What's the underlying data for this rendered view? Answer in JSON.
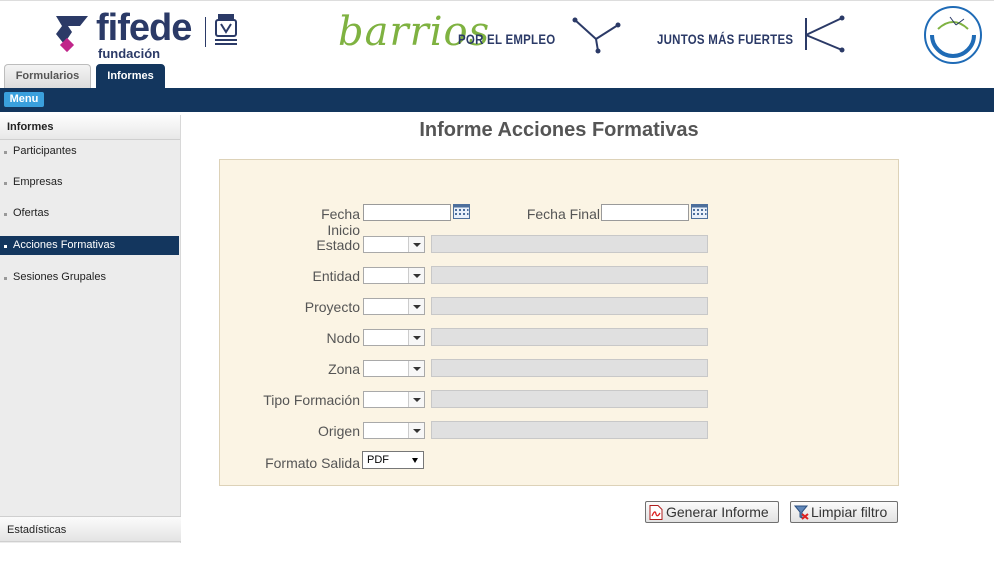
{
  "header": {
    "brand_word": "fifede",
    "brand_sub": "fundación",
    "partner_word": "barrios",
    "tagline_1": "POR EL EMPLEO",
    "tagline_2": "JUNTOS MÁS FUERTES",
    "colors": {
      "navy": "#13365e",
      "brand_blue": "#2b3a67",
      "green": "#7fb241",
      "accent": "#3aa0dd"
    }
  },
  "tabs": [
    {
      "label": "Formularios",
      "active": false
    },
    {
      "label": "Informes",
      "active": true
    }
  ],
  "navbar": {
    "menu_label": "Menu"
  },
  "sidebar": {
    "title": "Informes",
    "items": [
      {
        "label": "Participantes",
        "active": false
      },
      {
        "label": "Empresas",
        "active": false
      },
      {
        "label": "Ofertas",
        "active": false
      },
      {
        "label": "Acciones Formativas",
        "active": true
      },
      {
        "label": "Sesiones Grupales",
        "active": false
      }
    ],
    "footer": "Estadísticas"
  },
  "main": {
    "title": "Informe Acciones Formativas",
    "fecha_inicio_label": "Fecha Inicio",
    "fecha_inicio_line1": "Fecha",
    "fecha_inicio_line2": "Inicio",
    "fecha_inicio_value": "",
    "fecha_final_label": "Fecha Final",
    "fecha_final_value": "",
    "filters": [
      {
        "label": "Estado",
        "value": ""
      },
      {
        "label": "Entidad",
        "value": ""
      },
      {
        "label": "Proyecto",
        "value": ""
      },
      {
        "label": "Nodo",
        "value": ""
      },
      {
        "label": "Zona",
        "value": ""
      },
      {
        "label": "Tipo Formación",
        "value": ""
      },
      {
        "label": "Origen",
        "value": ""
      }
    ],
    "formato_label": "Formato Salida",
    "formato_value": "PDF",
    "buttons": {
      "generate": "Generar Informe",
      "clear": "Limpiar filtro"
    }
  }
}
